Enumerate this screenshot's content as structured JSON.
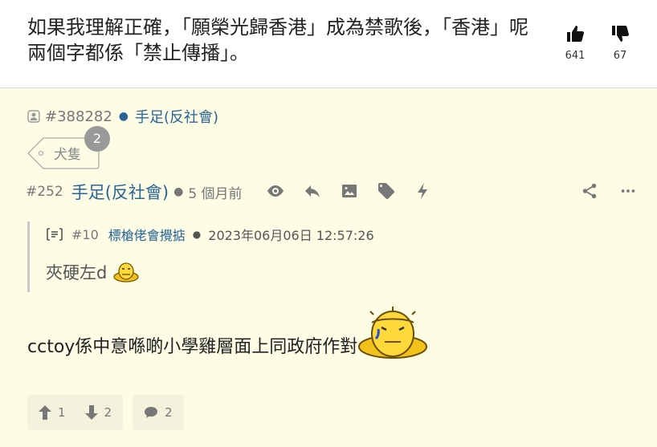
{
  "quote": {
    "text": "如果我理解正確，「願榮光歸香港」成為禁歌後，「香港」呢兩個字都係「禁止傳播」。",
    "likes": "641",
    "dislikes": "67"
  },
  "author_line": {
    "post_id": "#388282",
    "username": "手足(反社會)"
  },
  "tag": {
    "label": "犬隻",
    "badge": "2"
  },
  "reply": {
    "post_id": "#252",
    "username": "手足(反社會)",
    "time": "5 個月前"
  },
  "quoted": {
    "post_id": "#10",
    "username": "標槍佬會攪掂",
    "time": "2023年06月06日 12:57:26",
    "text": "夾硬左d"
  },
  "content": {
    "text": "cctoy係中意喺啲小學雞層面上同政府作對"
  },
  "footer": {
    "upvotes": "1",
    "downvotes": "2",
    "replies": "2"
  },
  "icons": [
    "thumbs-up-icon",
    "thumbs-down-icon",
    "person-icon",
    "eye-icon",
    "reply-icon",
    "image-icon",
    "tag-icon",
    "bolt-icon",
    "share-icon",
    "more-icon",
    "quote-icon",
    "arrow-up-icon",
    "arrow-down-icon",
    "comment-icon"
  ]
}
